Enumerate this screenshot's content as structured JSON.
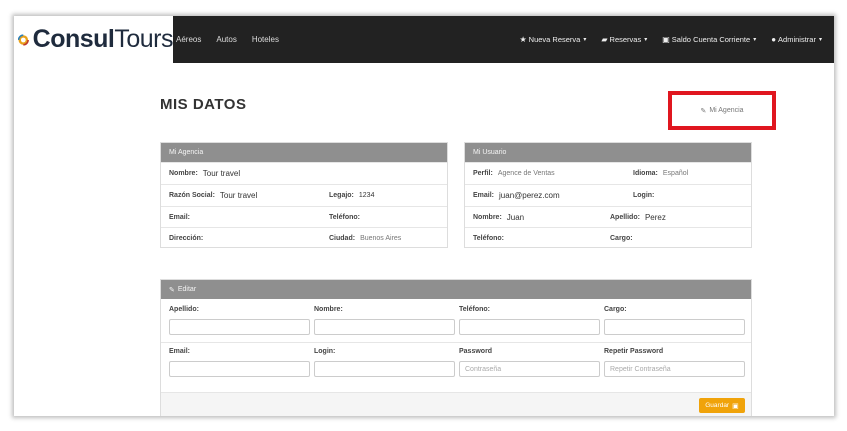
{
  "navbar": {
    "logo_bold": "Consul",
    "logo_light": "Tours",
    "left_links": [
      "Aéreos",
      "Autos",
      "Hoteles"
    ],
    "right_menu": [
      {
        "label": "Nueva Reserva",
        "icon": "star-icon",
        "glyph": "★"
      },
      {
        "label": "Reservas",
        "icon": "briefcase-icon",
        "glyph": "▰"
      },
      {
        "label": "Saldo Cuenta Corriente",
        "icon": "money-icon",
        "glyph": "▣"
      },
      {
        "label": "Administrar",
        "icon": "user-icon",
        "glyph": "●"
      }
    ],
    "caret": "▾"
  },
  "page": {
    "title": "MIS DATOS",
    "mi_agencia_label": "Mi Agencia",
    "mi_agencia_icon": "✎"
  },
  "agencia": {
    "header": "Mi Agencia",
    "nombre_label": "Nombre:",
    "nombre": "Tour travel",
    "razon_label": "Razón Social:",
    "razon": "Tour travel",
    "legajo_label": "Legajo:",
    "legajo": "1234",
    "email_label": "Email:",
    "telefono_label": "Teléfono:",
    "direccion_label": "Dirección:",
    "ciudad_label": "Ciudad:",
    "ciudad": "Buenos Aires"
  },
  "usuario": {
    "header": "Mi Usuario",
    "perfil_label": "Perfil:",
    "perfil": "Agence de Ventas",
    "idioma_label": "Idioma:",
    "idioma": "Español",
    "email_label": "Email:",
    "email": "juan@perez.com",
    "login_label": "Login:",
    "nombre_label": "Nombre:",
    "nombre": "Juan",
    "apellido_label": "Apellido:",
    "apellido": "Perez",
    "telefono_label": "Teléfono:",
    "cargo_label": "Cargo:"
  },
  "editar": {
    "header": "Editar",
    "header_icon": "✎",
    "fields": [
      {
        "label": "Apellido:",
        "placeholder": ""
      },
      {
        "label": "Nombre:",
        "placeholder": ""
      },
      {
        "label": "Teléfono:",
        "placeholder": ""
      },
      {
        "label": "Cargo:",
        "placeholder": ""
      },
      {
        "label": "Email:",
        "placeholder": ""
      },
      {
        "label": "Login:",
        "placeholder": ""
      },
      {
        "label": "Password",
        "placeholder": "Contraseña"
      },
      {
        "label": "Repetir Password",
        "placeholder": "Repetir Contraseña"
      }
    ],
    "save_label": "Guardar",
    "save_icon": "▣",
    "save_color": "#f0a30a"
  },
  "colors": {
    "navbar": "#222222",
    "panel_header": "#8f8f8f",
    "highlight_border": "#e0161f"
  }
}
